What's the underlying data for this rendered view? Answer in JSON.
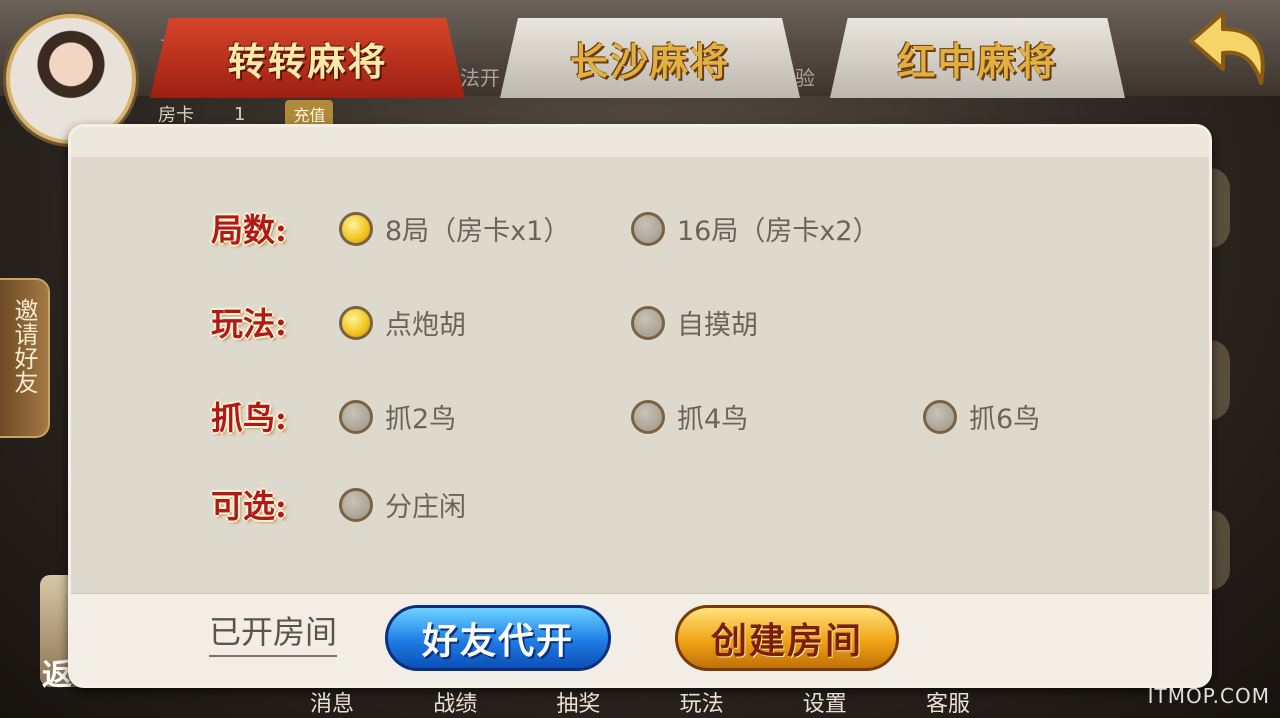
{
  "background": {
    "partial_labels": [
      "方",
      "丨",
      "玩法开",
      "体验"
    ],
    "room_card_label": "房卡",
    "room_card_count": "1",
    "recharge_label": "充值",
    "back_side_label": "返"
  },
  "tabs": [
    {
      "label": "转转麻将",
      "active": true
    },
    {
      "label": "长沙麻将",
      "active": false
    },
    {
      "label": "红中麻将",
      "active": false
    }
  ],
  "invite_label": "邀请好友",
  "settings": {
    "rounds": {
      "label": "局数:",
      "options": [
        {
          "label": "8局（房卡x1）",
          "selected": true
        },
        {
          "label": "16局（房卡x2）",
          "selected": false
        }
      ]
    },
    "play_mode": {
      "label": "玩法:",
      "options": [
        {
          "label": "点炮胡",
          "selected": true
        },
        {
          "label": "自摸胡",
          "selected": false
        }
      ]
    },
    "catch_bird": {
      "label": "抓鸟:",
      "options": [
        {
          "label": "抓2鸟",
          "selected": false
        },
        {
          "label": "抓4鸟",
          "selected": false
        },
        {
          "label": "抓6鸟",
          "selected": false
        }
      ]
    },
    "optional": {
      "label": "可选:",
      "options": [
        {
          "label": "分庄闲",
          "selected": false
        }
      ]
    }
  },
  "actions": {
    "opened_rooms": "已开房间",
    "open_for_friend": "好友代开",
    "create_room": "创建房间"
  },
  "bottom_nav": [
    "消息",
    "战绩",
    "抽奖",
    "玩法",
    "设置",
    "客服"
  ],
  "watermark": "ITMOP.COM",
  "colors": {
    "tab_active": "#c2351f",
    "label_red": "#b0191b",
    "radio_selected": "#f2c21c",
    "button_blue": "#1f7de6",
    "button_gold": "#f0a414",
    "panel_bg": "#ded9cd"
  }
}
